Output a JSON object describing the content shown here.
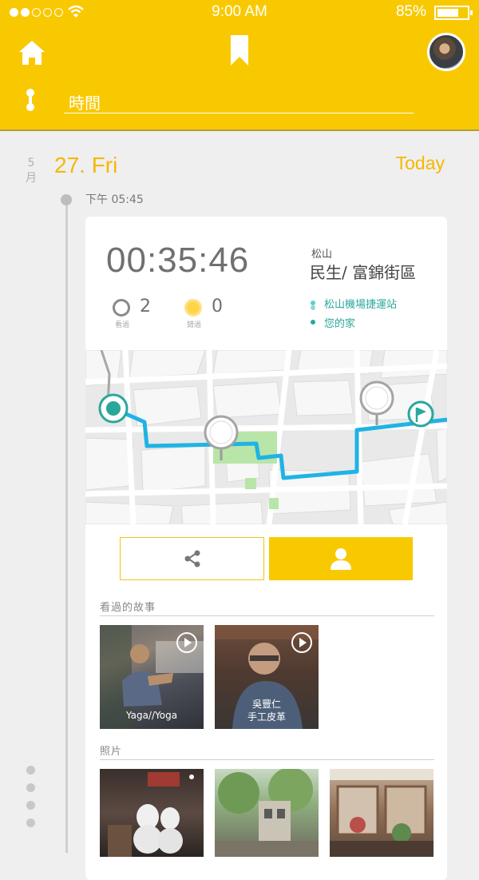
{
  "status_bar": {
    "time": "9:00  AM",
    "battery_pct": "85%",
    "signal_bars_on": 2,
    "signal_bars_total": 5,
    "battery_level": 0.85
  },
  "header": {
    "search_value": "時間",
    "icons": [
      "home-icon",
      "bookmark-icon",
      "avatar",
      "route-icon"
    ]
  },
  "timeline": {
    "month": "5",
    "month_unit": "月",
    "date": "27. Fri",
    "today_label": "Today",
    "entry_time": "下午 05:45"
  },
  "card": {
    "duration": "00:35:46",
    "seen_count": "2",
    "seen_label": "看過",
    "passed_count": "0",
    "passed_label": "錯過",
    "location_area": "松山",
    "location_name": "民生/ 富錦街區",
    "stops": [
      "松山機場捷運站",
      "您的家"
    ],
    "share_icon": "share-icon",
    "person_icon": "person-icon",
    "stories_heading": "看過的故事",
    "stories": [
      {
        "caption": "Yaga//Yoga"
      },
      {
        "caption_line1": "吳豐仁",
        "caption_line2": "手工皮革"
      }
    ],
    "photos_heading": "照片"
  },
  "colors": {
    "brand_yellow": "#f8c900",
    "accent_orange": "#f5b800",
    "route_blue": "#1fb3e6",
    "teal": "#2aa79b"
  }
}
